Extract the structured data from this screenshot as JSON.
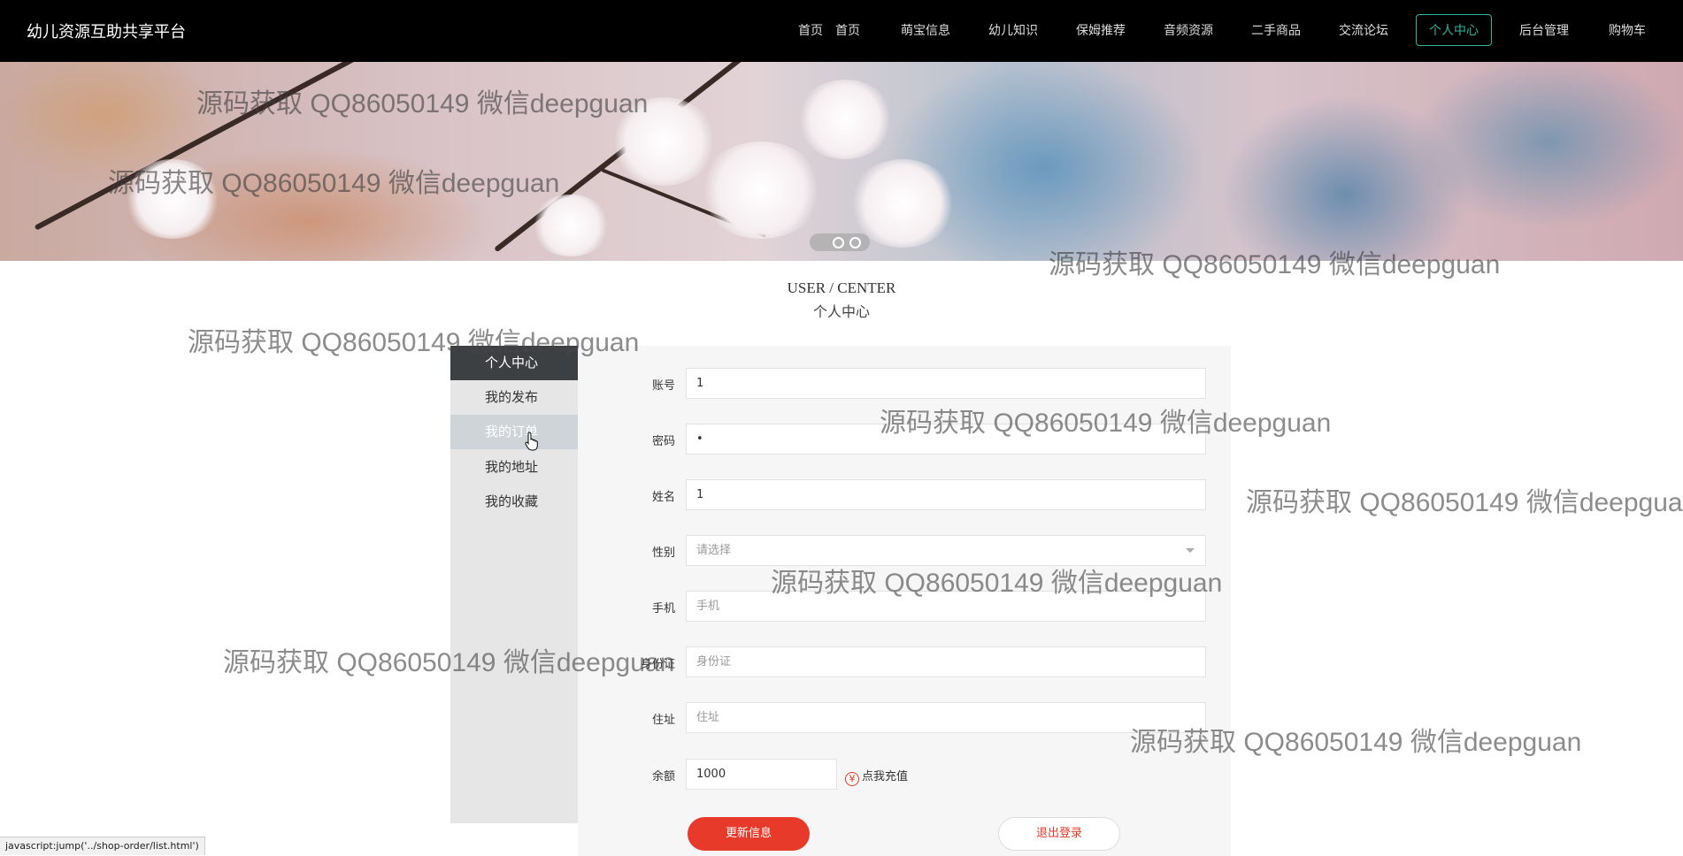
{
  "brand": "幼儿资源互助共享平台",
  "nav": {
    "items": [
      {
        "label": "首页"
      },
      {
        "label": "萌宝信息"
      },
      {
        "label": "幼儿知识"
      },
      {
        "label": "保姆推荐"
      },
      {
        "label": "音频资源"
      },
      {
        "label": "二手商品"
      },
      {
        "label": "交流论坛"
      },
      {
        "label": "个人中心",
        "active": true
      },
      {
        "label": "后台管理"
      },
      {
        "label": "购物车"
      }
    ]
  },
  "banner": {
    "carousel_pages": 3,
    "active_page": 1
  },
  "section": {
    "title_en": "USER / CENTER",
    "title_cn": "个人中心"
  },
  "sidebar": {
    "items": [
      {
        "label": "个人中心",
        "state": "active"
      },
      {
        "label": "我的发布",
        "state": "normal"
      },
      {
        "label": "我的订单",
        "state": "hover"
      },
      {
        "label": "我的地址",
        "state": "normal"
      },
      {
        "label": "我的收藏",
        "state": "normal"
      }
    ]
  },
  "form": {
    "account": {
      "label": "账号",
      "value": "1"
    },
    "password": {
      "label": "密码",
      "value": "•"
    },
    "name": {
      "label": "姓名",
      "value": "1"
    },
    "gender": {
      "label": "性别",
      "placeholder": "请选择"
    },
    "phone": {
      "label": "手机",
      "placeholder": "手机"
    },
    "id_card": {
      "label": "身份证",
      "placeholder": "身份证"
    },
    "address": {
      "label": "住址",
      "placeholder": "住址"
    },
    "balance": {
      "label": "余额",
      "value": "1000"
    },
    "recharge_icon": "¥",
    "recharge_label": "点我充值",
    "update_button": "更新信息",
    "logout_button": "退出登录"
  },
  "watermark_text": "源码获取 QQ86050149 微信deepguan",
  "status_bar": "javascript:jump('../shop-order/list.html')",
  "colors": {
    "topbar": "#000000",
    "accent_green": "#2fb39a",
    "accent_red": "#e83a2b",
    "sidebar_active": "#3d4043",
    "panel_bg": "#f6f6f6"
  }
}
